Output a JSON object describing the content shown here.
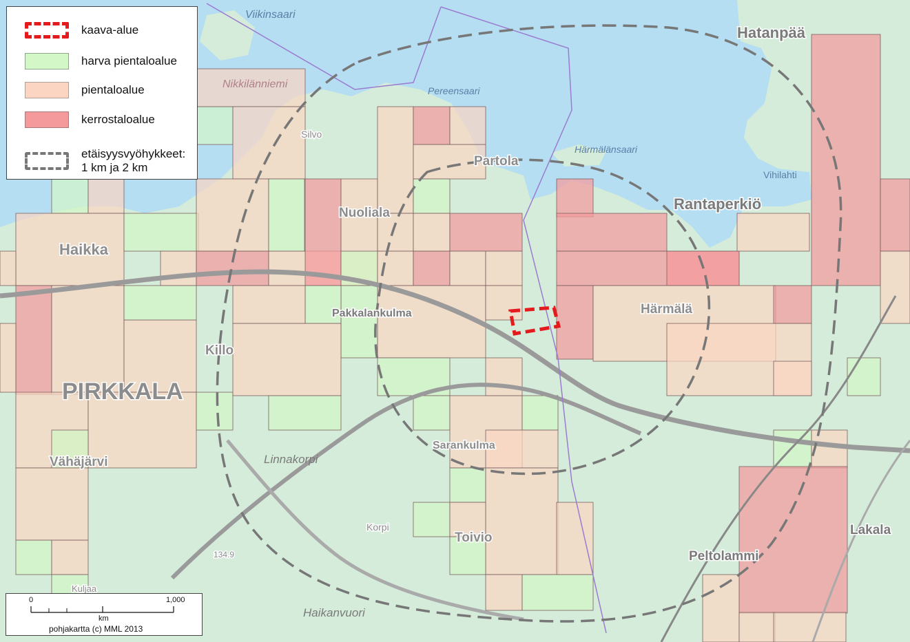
{
  "legend": {
    "items": [
      {
        "label": "kaava-alue"
      },
      {
        "label": "harva pientaloalue"
      },
      {
        "label": "pientaloalue"
      },
      {
        "label": "kerrostaloalue"
      },
      {
        "label_line1": "etäisyysvyöhykkeet:",
        "label_line2": "1 km ja 2 km"
      }
    ]
  },
  "colors": {
    "plan_area": "#e41a1c",
    "sparse_detached": "#d3f7c6",
    "detached": "#fbd5c2",
    "apartment": "#f49a9c",
    "distance_zone": "#777777",
    "water": "#b5def3",
    "land": "#d4ecd9"
  },
  "places": {
    "hatanpaa": "Hatanpää",
    "partola": "Partola",
    "rantaperkio": "Rantaperkiö",
    "nuolialan": "Nuoliala",
    "haikka": "Haikka",
    "pakkalankulma": "Pakkalankulma",
    "harmala": "Härmälä",
    "killo": "Killo",
    "pirkkala": "PIRKKALA",
    "vahajarvi": "Vähäjärvi",
    "sarankulma": "Sarankulma",
    "toivio": "Toivio",
    "peltolammi": "Peltolammi",
    "lakala": "Lakala",
    "silvo": "Silvo",
    "linnakorpi": "Linnakorpi",
    "korpi": "Korpi",
    "haikanvuori": "Haikanvuori",
    "kuljaa": "Kuljaa",
    "vihilahti": "Vihilahti",
    "elevation": "134.9"
  },
  "water_names": {
    "viikinsaari": "Viikinsaari",
    "nikkilanniemi": "Nikkilänniemi",
    "pereensaari": "Pereensaari",
    "harmalansaari": "Härmälänsaari"
  },
  "scale": {
    "start": "0",
    "end": "1,000",
    "unit": "km",
    "credit": "pohjakartta (c) MML 2013"
  }
}
